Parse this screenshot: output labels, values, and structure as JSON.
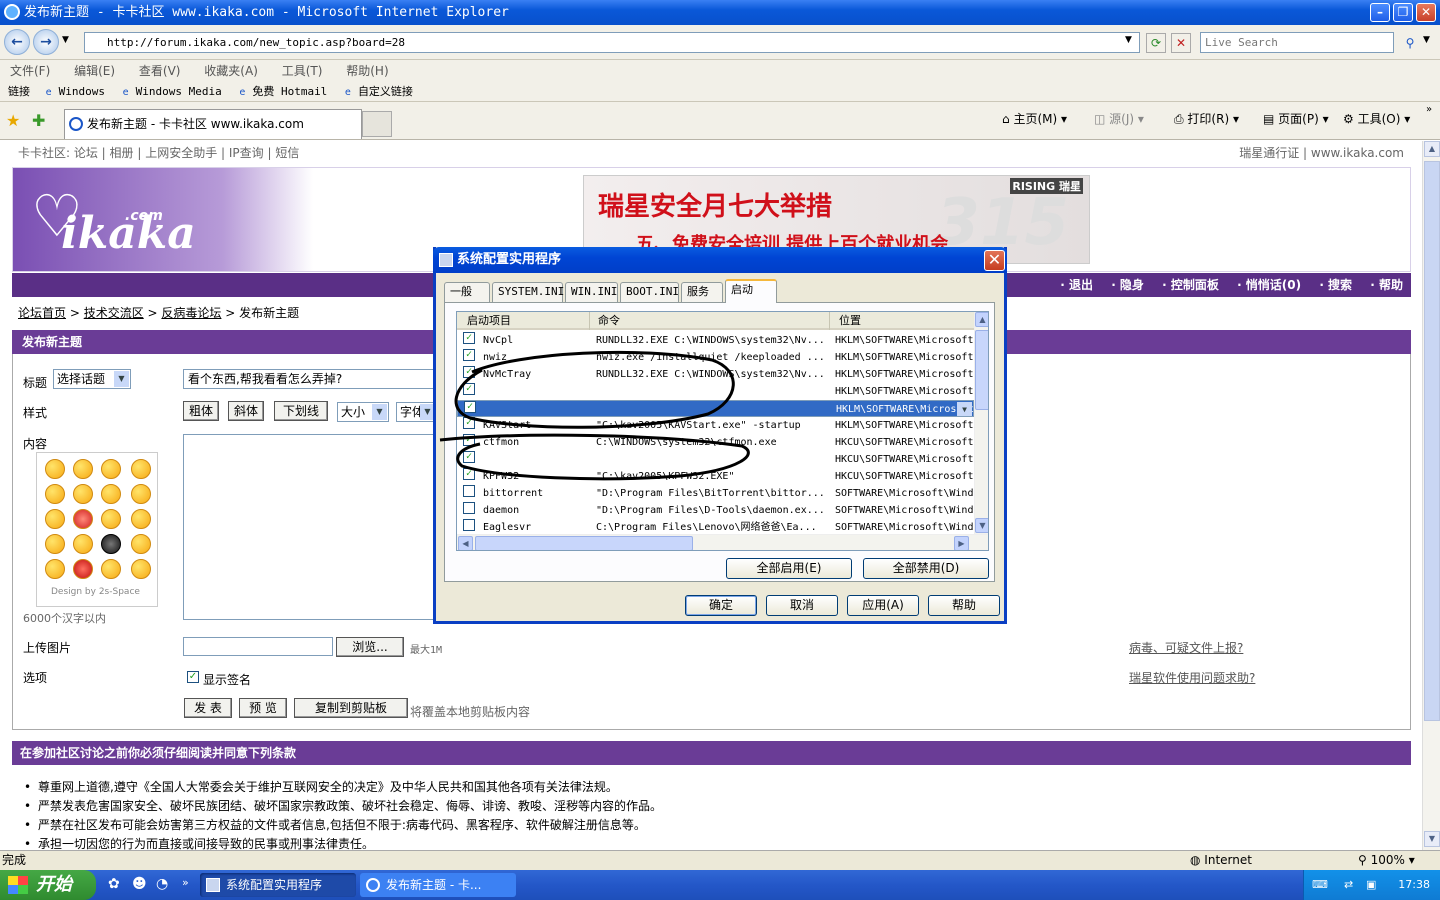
{
  "window": {
    "title": "发布新主题 - 卡卡社区 www.ikaka.com - Microsoft Internet Explorer"
  },
  "address": {
    "url": "http://forum.ikaka.com/new_topic.asp?board=28",
    "search_placeholder": "Live Search"
  },
  "menu": [
    "文件(F)",
    "编辑(E)",
    "查看(V)",
    "收藏夹(A)",
    "工具(T)",
    "帮助(H)"
  ],
  "links": {
    "label": "链接",
    "items": [
      "Windows",
      "Windows Media",
      "免费 Hotmail",
      "自定义链接"
    ]
  },
  "tab": {
    "title": "发布新主题 - 卡卡社区 www.ikaka.com"
  },
  "toolbar": {
    "home": "主页(M)",
    "feeds": "源(J)",
    "print": "打印(R)",
    "page": "页面(P)",
    "tools": "工具(O)"
  },
  "site": {
    "topnav": "卡卡社区: 论坛 | 相册 | 上网安全助手 | IP查询 | 短信",
    "topnav_right": "瑞星通行证 | www.ikaka.com",
    "logo": "ikaka",
    "logo_com": ".com",
    "ad_headline": "瑞星安全月七大举措",
    "ad_sub": "五、免费安全培训 提供上百个就业机会",
    "ad_brand": "RISING 瑞星",
    "nav": [
      "· 退出",
      "· 隐身",
      "· 控制面板",
      "· 悄悄话(0)",
      "· 搜索",
      "· 帮助"
    ],
    "breadcrumb": [
      "论坛首页",
      "技术交流区",
      "反病毒论坛",
      "发布新主题"
    ]
  },
  "form": {
    "header": "发布新主题",
    "title_label": "标题",
    "topic_select": "选择话题",
    "title_value": "看个东西,帮我看看怎么弄掉?",
    "style_label": "样式",
    "bold": "粗体",
    "italic": "斜体",
    "underline": "下划线",
    "size": "大小",
    "font": "字体",
    "content_label": "内容",
    "emoji_credit": "Design by 2s-Space",
    "char_limit": "6000个汉字以内",
    "upload_label": "上传图片",
    "browse": "浏览...",
    "max_size": "最大1M",
    "options_label": "选项",
    "show_signature": "显示签名",
    "submit": "发 表",
    "preview": "预 览",
    "copy": "复制到剪贴板",
    "copy_note": "将覆盖本地剪贴板内容",
    "report_link": "病毒、可疑文件上报?",
    "help_link": "瑞星软件使用问题求助?"
  },
  "rules": {
    "header": "在参加社区讨论之前你必须仔细阅读并同意下列条款",
    "items": [
      "尊重网上道德,遵守《全国人大常委会关于维护互联网安全的决定》及中华人民共和国其他各项有关法律法规。",
      "严禁发表危害国家安全、破坏民族团结、破坏国家宗教政策、破坏社会稳定、侮辱、诽谤、教唆、淫秽等内容的作品。",
      "严禁在社区发布可能会妨害第三方权益的文件或者信息,包括但不限于:病毒代码、黑客程序、软件破解注册信息等。",
      "承担一切因您的行为而直接或间接导致的民事或刑事法律责任。"
    ]
  },
  "status": {
    "text": "完成",
    "zone": "Internet",
    "zoom": "100%"
  },
  "taskbar": {
    "start": "开始",
    "tasks": [
      "系统配置实用程序",
      "发布新主题 - 卡..."
    ],
    "time": "17:38"
  },
  "dialog": {
    "title": "系统配置实用程序",
    "tabs": [
      "一般",
      "SYSTEM.INI",
      "WIN.INI",
      "BOOT.INI",
      "服务",
      "启动"
    ],
    "columns": [
      "启动项目",
      "命令",
      "位置"
    ],
    "rows": [
      {
        "checked": true,
        "name": "NvCpl",
        "command": "RUNDLL32.EXE C:\\WINDOWS\\system32\\Nv...",
        "location": "HKLM\\SOFTWARE\\Microsoft"
      },
      {
        "checked": true,
        "name": "nwiz",
        "command": "nwiz.exe /installquiet /keeploaded ...",
        "location": "HKLM\\SOFTWARE\\Microsoft"
      },
      {
        "checked": true,
        "name": "NvMcTray",
        "command": "RUNDLL32.EXE C:\\WINDOWS\\system32\\Nv...",
        "location": "HKLM\\SOFTWARE\\Microsoft"
      },
      {
        "checked": true,
        "name": "",
        "command": "",
        "location": "HKLM\\SOFTWARE\\Microsoft"
      },
      {
        "checked": true,
        "name": "",
        "command": "",
        "location": "HKLM\\SOFTWARE\\Microsoft",
        "selected": true
      },
      {
        "checked": true,
        "name": "KAVStart",
        "command": "\"C:\\kav2005\\KAVStart.exe\" -startup",
        "location": "HKLM\\SOFTWARE\\Microsoft"
      },
      {
        "checked": true,
        "name": "ctfmon",
        "command": "C:\\WINDOWS\\system32\\ctfmon.exe",
        "location": "HKCU\\SOFTWARE\\Microsoft"
      },
      {
        "checked": true,
        "name": "",
        "command": "",
        "location": "HKCU\\SOFTWARE\\Microsoft"
      },
      {
        "checked": true,
        "name": "KPFW32",
        "command": "\"C:\\kav2005\\KPFW32.EXE\"",
        "location": "HKCU\\SOFTWARE\\Microsoft"
      },
      {
        "checked": false,
        "name": "bittorrent",
        "command": "\"D:\\Program Files\\BitTorrent\\bittor...",
        "location": "SOFTWARE\\Microsoft\\Wind"
      },
      {
        "checked": false,
        "name": "daemon",
        "command": "\"D:\\Program Files\\D-Tools\\daemon.ex...",
        "location": "SOFTWARE\\Microsoft\\Wind"
      },
      {
        "checked": false,
        "name": "Eaglesvr",
        "command": "C:\\Program Files\\Lenovo\\网络爸爸\\Ea...",
        "location": "SOFTWARE\\Microsoft\\Wind"
      }
    ],
    "enable_all": "全部启用(E)",
    "disable_all": "全部禁用(D)",
    "ok": "确定",
    "cancel": "取消",
    "apply": "应用(A)",
    "help": "帮助"
  }
}
